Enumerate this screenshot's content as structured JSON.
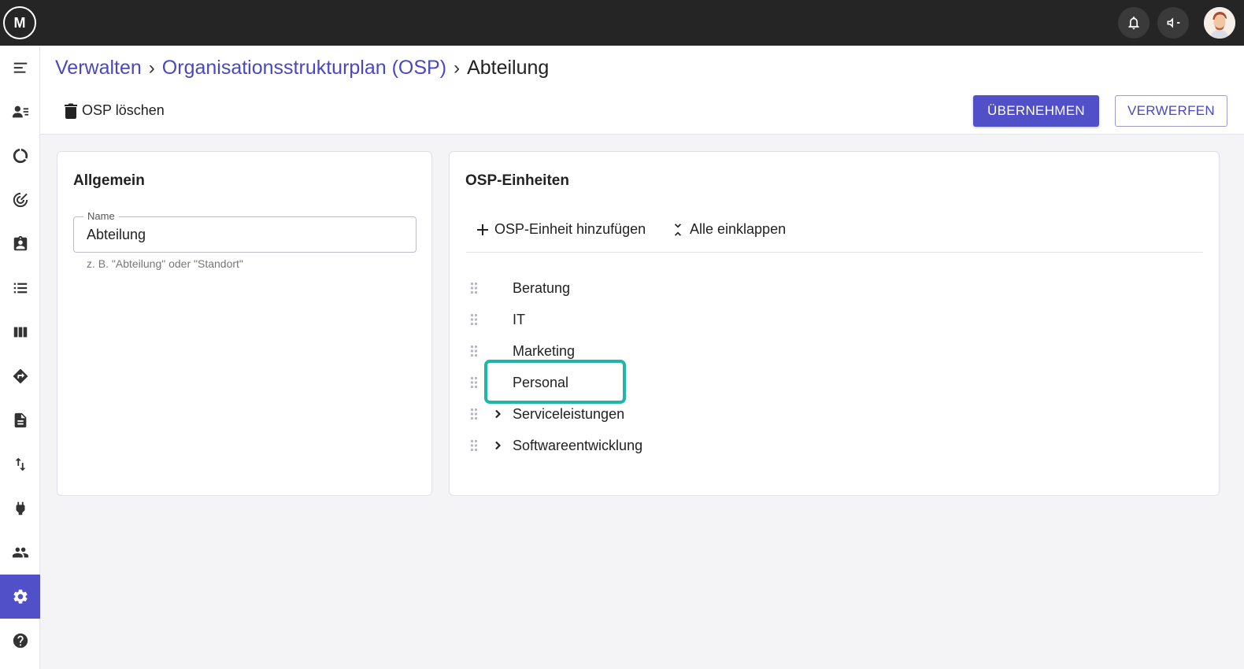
{
  "app": {
    "logo_text": "M",
    "colors": {
      "accent": "#5150c8",
      "highlight": "#1fb5a8",
      "topbar": "#252525"
    }
  },
  "topbar": {
    "icons": [
      "bell-icon",
      "megaphone-icon",
      "user-avatar"
    ]
  },
  "sidebar": {
    "items": [
      {
        "icon": "menu-collapse-icon"
      },
      {
        "icon": "contacts-icon"
      },
      {
        "icon": "donut-chart-icon"
      },
      {
        "icon": "target-icon"
      },
      {
        "icon": "clipboard-icon"
      },
      {
        "icon": "list-icon"
      },
      {
        "icon": "columns-icon"
      },
      {
        "icon": "directions-icon"
      },
      {
        "icon": "document-icon"
      },
      {
        "icon": "swap-vertical-icon"
      },
      {
        "icon": "plug-icon"
      },
      {
        "icon": "people-icon"
      },
      {
        "icon": "settings-icon",
        "active": true
      },
      {
        "icon": "help-icon"
      }
    ]
  },
  "header": {
    "breadcrumb": [
      "Verwalten",
      "Organisationsstrukturplan (OSP)",
      "Abteilung"
    ],
    "delete_label": "OSP löschen",
    "apply_label": "ÜBERNEHMEN",
    "discard_label": "VERWERFEN"
  },
  "general": {
    "title": "Allgemein",
    "name_label": "Name",
    "name_value": "Abteilung",
    "name_hint": "z. B. \"Abteilung\" oder \"Standort\""
  },
  "units": {
    "title": "OSP-Einheiten",
    "add_label": "OSP-Einheit hinzufügen",
    "collapse_label": "Alle einklappen",
    "items": [
      {
        "label": "Beratung",
        "expandable": false
      },
      {
        "label": "IT",
        "expandable": false
      },
      {
        "label": "Marketing",
        "expandable": false
      },
      {
        "label": "Personal",
        "expandable": false,
        "highlighted": true
      },
      {
        "label": "Serviceleistungen",
        "expandable": true
      },
      {
        "label": "Softwareentwicklung",
        "expandable": true
      }
    ]
  }
}
